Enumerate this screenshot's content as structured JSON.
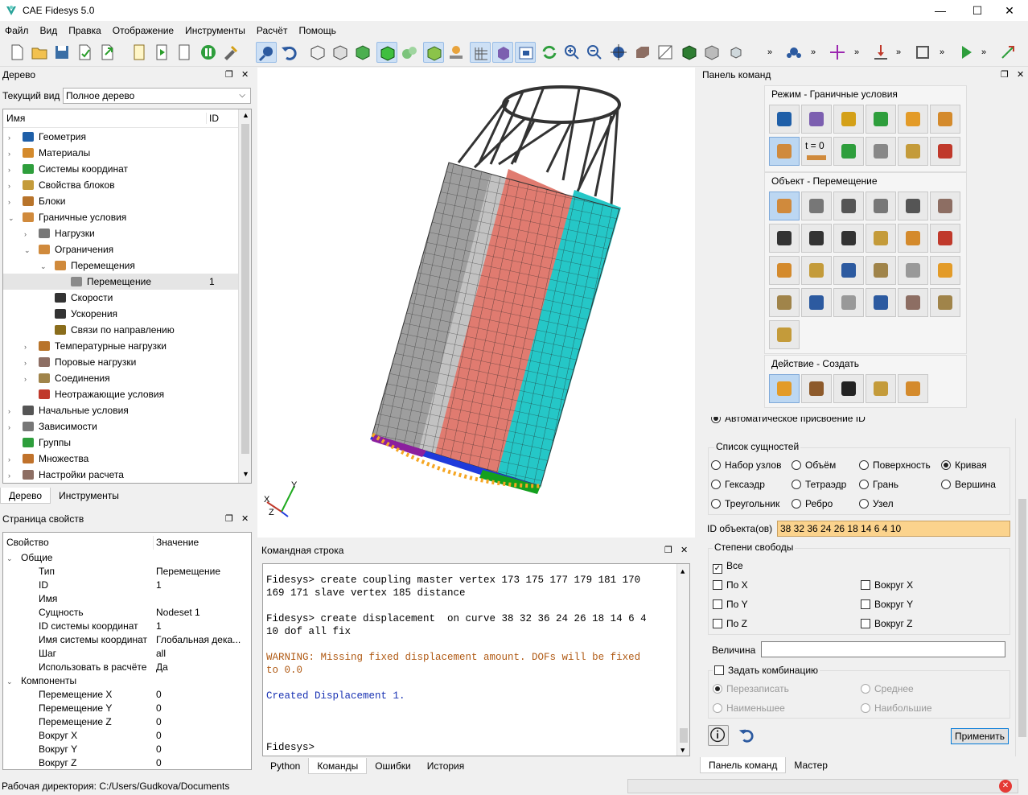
{
  "app": {
    "title": "CAE Fidesys 5.0"
  },
  "menu": [
    "Файл",
    "Вид",
    "Правка",
    "Отображение",
    "Инструменты",
    "Расчёт",
    "Помощь"
  ],
  "tree_panel": {
    "title": "Дерево",
    "view_label": "Текущий вид",
    "view_value": "Полное дерево",
    "col_name": "Имя",
    "col_id": "ID",
    "items": [
      {
        "label": "Геометрия",
        "id": ""
      },
      {
        "label": "Материалы",
        "id": ""
      },
      {
        "label": "Системы координат",
        "id": ""
      },
      {
        "label": "Свойства блоков",
        "id": ""
      },
      {
        "label": "Блоки",
        "id": ""
      },
      {
        "label": "Граничные условия",
        "id": ""
      },
      {
        "label": "Нагрузки",
        "id": ""
      },
      {
        "label": "Ограничения",
        "id": ""
      },
      {
        "label": "Перемещения",
        "id": ""
      },
      {
        "label": "Перемещение",
        "id": "1"
      },
      {
        "label": "Скорости",
        "id": ""
      },
      {
        "label": "Ускорения",
        "id": ""
      },
      {
        "label": "Связи по направлению",
        "id": ""
      },
      {
        "label": "Температурные нагрузки",
        "id": ""
      },
      {
        "label": "Поровые нагрузки",
        "id": ""
      },
      {
        "label": "Соединения",
        "id": ""
      },
      {
        "label": "Неотражающие условия",
        "id": ""
      },
      {
        "label": "Начальные условия",
        "id": ""
      },
      {
        "label": "Зависимости",
        "id": ""
      },
      {
        "label": "Группы",
        "id": ""
      },
      {
        "label": "Множества",
        "id": ""
      },
      {
        "label": "Настройки расчета",
        "id": ""
      }
    ],
    "tabs": [
      "Дерево",
      "Инструменты"
    ]
  },
  "props_panel": {
    "title": "Страница свойств",
    "col_prop": "Свойство",
    "col_val": "Значение",
    "group_general": "Общие",
    "rows": [
      {
        "k": "Тип",
        "v": "Перемещение"
      },
      {
        "k": "ID",
        "v": "1"
      },
      {
        "k": "Имя",
        "v": ""
      },
      {
        "k": "Сущность",
        "v": "Nodeset 1"
      },
      {
        "k": "ID системы координат",
        "v": "1"
      },
      {
        "k": "Имя системы координат",
        "v": "Глобальная дека..."
      },
      {
        "k": "Шаг",
        "v": "all"
      },
      {
        "k": "Использовать в расчёте",
        "v": "Да"
      }
    ],
    "group_components": "Компоненты",
    "components": [
      {
        "k": "Перемещение X",
        "v": "0"
      },
      {
        "k": "Перемещение Y",
        "v": "0"
      },
      {
        "k": "Перемещение Z",
        "v": "0"
      },
      {
        "k": "Вокруг X",
        "v": "0"
      },
      {
        "k": "Вокруг Y",
        "v": "0"
      },
      {
        "k": "Вокруг Z",
        "v": "0"
      }
    ]
  },
  "console": {
    "title": "Командная строка",
    "lines": [
      {
        "t": "Fidesys> create coupling master vertex 173 175 177 179 181 170",
        "c": "cmd"
      },
      {
        "t": "169 171 slave vertex 185 distance",
        "c": "cmd"
      },
      {
        "t": "",
        "c": "cmd"
      },
      {
        "t": "Fidesys> create displacement  on curve 38 32 36 24 26 18 14 6 4",
        "c": "cmd"
      },
      {
        "t": "10 dof all fix",
        "c": "cmd"
      },
      {
        "t": "",
        "c": "cmd"
      },
      {
        "t": "WARNING: Missing fixed displacement amount. DOFs will be fixed",
        "c": "warn"
      },
      {
        "t": "to 0.0",
        "c": "warn"
      },
      {
        "t": "",
        "c": "cmd"
      },
      {
        "t": "Created Displacement 1.",
        "c": "info"
      }
    ],
    "prompt": "Fidesys>",
    "tabs": [
      "Python",
      "Команды",
      "Ошибки",
      "История"
    ]
  },
  "cmd_panel": {
    "title": "Панель команд",
    "mode_title": "Режим - Граничные условия",
    "mode_t0": "t = 0",
    "object_title": "Объект - Перемещение",
    "action_title": "Действие - Создать",
    "cut_text": "Автоматическое присвоение ID",
    "entity_list_title": "Список сущностей",
    "entities": [
      {
        "label": "Набор узлов",
        "on": false
      },
      {
        "label": "Объём",
        "on": false
      },
      {
        "label": "Поверхность",
        "on": false
      },
      {
        "label": "Кривая",
        "on": true
      },
      {
        "label": "Гексаэдр",
        "on": false
      },
      {
        "label": "Тетраэдр",
        "on": false
      },
      {
        "label": "Грань",
        "on": false
      },
      {
        "label": "Вершина",
        "on": false
      },
      {
        "label": "Треугольник",
        "on": false
      },
      {
        "label": "Ребро",
        "on": false
      },
      {
        "label": "Узел",
        "on": false
      }
    ],
    "object_id_label": "ID объекта(ов)",
    "object_id_value": "38 32 36 24 26 18 14 6 4 10",
    "dof_title": "Степени свободы",
    "dof_all": "Все",
    "dof": [
      "По X",
      "Вокруг X",
      "По Y",
      "Вокруг Y",
      "По Z",
      "Вокруг Z"
    ],
    "magnitude_label": "Величина",
    "combo_label": "Задать комбинацию",
    "combo_opts": [
      "Перезаписать",
      "Среднее",
      "Наименьшее",
      "Наибольшие"
    ],
    "apply": "Применить",
    "tabs": [
      "Панель команд",
      "Мастер"
    ]
  },
  "status": {
    "workdir": "Рабочая директория: C:/Users/Gudkova/Documents"
  },
  "axes": {
    "x": "X",
    "y": "Y",
    "z": "Z"
  },
  "colors": {
    "accent": "#0078d7",
    "selection": "#cde0f5",
    "id_field": "#fbd38d",
    "warn": "#b05a14",
    "info": "#1a33b3"
  }
}
